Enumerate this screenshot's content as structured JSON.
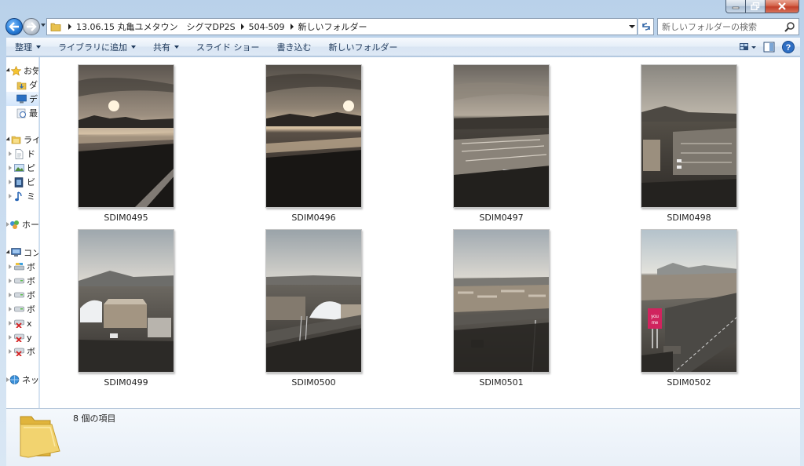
{
  "address": {
    "crumbs": [
      "13.06.15 丸亀ユメタウン　シグマDP2S",
      "504-509",
      "新しいフォルダー"
    ]
  },
  "search": {
    "placeholder": "新しいフォルダーの検索"
  },
  "toolbar": {
    "organize": "整理",
    "add_to_library": "ライブラリに追加",
    "share": "共有",
    "slideshow": "スライド ショー",
    "burn": "書き込む",
    "new_folder": "新しいフォルダー"
  },
  "nav": {
    "items": [
      {
        "label": "お気",
        "icon": "star-icon",
        "expanded": true
      },
      {
        "label": "ダ",
        "icon": "download-folder-icon"
      },
      {
        "label": "デ",
        "icon": "desktop-icon",
        "selected": true
      },
      {
        "label": "最",
        "icon": "recent-places-icon"
      },
      {
        "label": "ライ",
        "icon": "libraries-icon",
        "expanded": true
      },
      {
        "label": "ド",
        "icon": "documents-icon"
      },
      {
        "label": "ピ",
        "icon": "pictures-icon"
      },
      {
        "label": "ビ",
        "icon": "videos-icon"
      },
      {
        "label": "ミ",
        "icon": "music-icon"
      },
      {
        "label": "ホー",
        "icon": "homegroup-icon"
      },
      {
        "label": "コン",
        "icon": "computer-icon",
        "expanded": true
      },
      {
        "label": "ボ",
        "icon": "local-disk-icon"
      },
      {
        "label": "ボ",
        "icon": "drive-icon"
      },
      {
        "label": "ボ",
        "icon": "drive-icon"
      },
      {
        "label": "ボ",
        "icon": "drive-icon"
      },
      {
        "label": "x",
        "icon": "network-drive-disconnected-icon"
      },
      {
        "label": "y",
        "icon": "network-drive-disconnected-icon"
      },
      {
        "label": "ボ",
        "icon": "network-drive-disconnected-icon"
      },
      {
        "label": "ネッ",
        "icon": "network-icon"
      }
    ]
  },
  "files": [
    {
      "name": "SDIM0495"
    },
    {
      "name": "SDIM0496"
    },
    {
      "name": "SDIM0497"
    },
    {
      "name": "SDIM0498"
    },
    {
      "name": "SDIM0499"
    },
    {
      "name": "SDIM0500"
    },
    {
      "name": "SDIM0501"
    },
    {
      "name": "SDIM0502"
    }
  ],
  "status": {
    "item_count": "8 個の項目"
  },
  "colors": {
    "accent": "#1e395b",
    "selection": "#d3e6fb"
  }
}
